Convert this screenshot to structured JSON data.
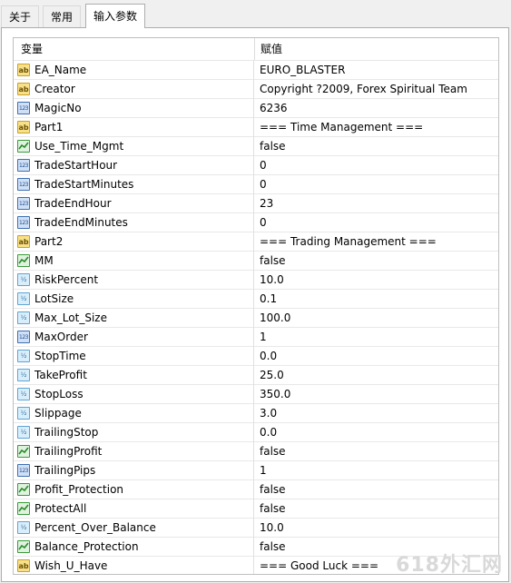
{
  "tabs": [
    {
      "label": "关于",
      "active": false
    },
    {
      "label": "常用",
      "active": false
    },
    {
      "label": "输入参数",
      "active": true
    }
  ],
  "grid": {
    "header": {
      "variable": "变量",
      "value": "赋值"
    },
    "rows": [
      {
        "type": "string",
        "icon": "ab",
        "name": "EA_Name",
        "value": "EURO_BLASTER"
      },
      {
        "type": "string",
        "icon": "ab",
        "name": "Creator",
        "value": "Copyright ?2009, Forex Spiritual Team"
      },
      {
        "type": "int",
        "icon": "123",
        "name": "MagicNo",
        "value": "6236"
      },
      {
        "type": "string",
        "icon": "ab",
        "name": "Part1",
        "value": "=== Time Management ==="
      },
      {
        "type": "bool",
        "icon": "",
        "name": "Use_Time_Mgmt",
        "value": "false"
      },
      {
        "type": "int",
        "icon": "123",
        "name": "TradeStartHour",
        "value": "0"
      },
      {
        "type": "int",
        "icon": "123",
        "name": "TradeStartMinutes",
        "value": "0"
      },
      {
        "type": "int",
        "icon": "123",
        "name": "TradeEndHour",
        "value": "23"
      },
      {
        "type": "int",
        "icon": "123",
        "name": "TradeEndMinutes",
        "value": "0"
      },
      {
        "type": "string",
        "icon": "ab",
        "name": "Part2",
        "value": "=== Trading Management ==="
      },
      {
        "type": "bool",
        "icon": "",
        "name": "MM",
        "value": "false"
      },
      {
        "type": "double",
        "icon": "½",
        "name": "RiskPercent",
        "value": "10.0"
      },
      {
        "type": "double",
        "icon": "½",
        "name": "LotSize",
        "value": "0.1"
      },
      {
        "type": "double",
        "icon": "½",
        "name": "Max_Lot_Size",
        "value": "100.0"
      },
      {
        "type": "int",
        "icon": "123",
        "name": "MaxOrder",
        "value": "1"
      },
      {
        "type": "double",
        "icon": "½",
        "name": "StopTime",
        "value": "0.0"
      },
      {
        "type": "double",
        "icon": "½",
        "name": "TakeProfit",
        "value": "25.0"
      },
      {
        "type": "double",
        "icon": "½",
        "name": "StopLoss",
        "value": "350.0"
      },
      {
        "type": "double",
        "icon": "½",
        "name": "Slippage",
        "value": "3.0"
      },
      {
        "type": "double",
        "icon": "½",
        "name": "TrailingStop",
        "value": "0.0"
      },
      {
        "type": "bool",
        "icon": "",
        "name": "TrailingProfit",
        "value": "false"
      },
      {
        "type": "int",
        "icon": "123",
        "name": "TrailingPips",
        "value": "1"
      },
      {
        "type": "bool",
        "icon": "",
        "name": "Profit_Protection",
        "value": "false"
      },
      {
        "type": "bool",
        "icon": "",
        "name": "ProtectAll",
        "value": "false"
      },
      {
        "type": "double",
        "icon": "½",
        "name": "Percent_Over_Balance",
        "value": "10.0"
      },
      {
        "type": "bool",
        "icon": "",
        "name": "Balance_Protection",
        "value": "false"
      },
      {
        "type": "string",
        "icon": "ab",
        "name": "Wish_U_Have",
        "value": "=== Good Luck ==="
      }
    ]
  },
  "watermark": "618外汇网"
}
